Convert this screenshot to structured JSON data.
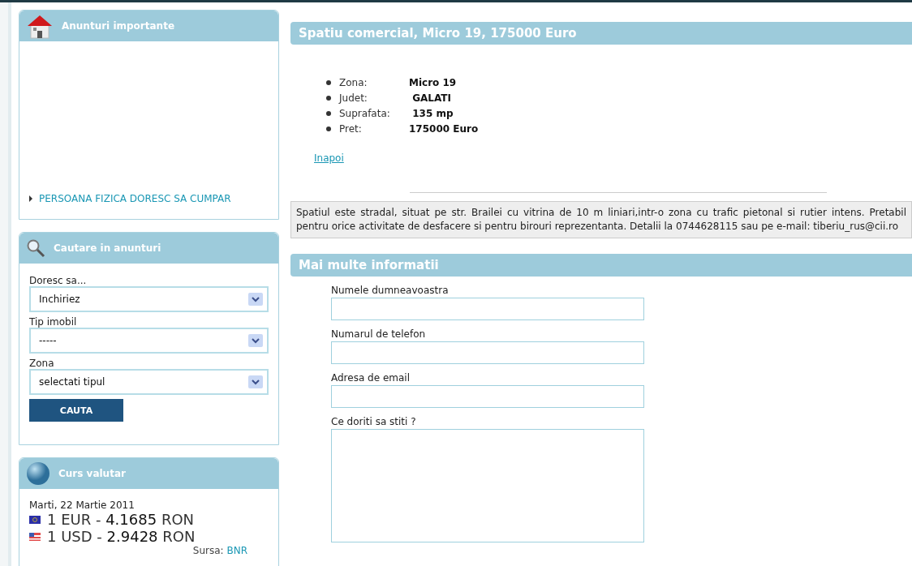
{
  "sidebar": {
    "important_ads": {
      "title": "Anunturi importante",
      "items": [
        "PERSOANA FIZICA DORESC SA CUMPAR"
      ]
    },
    "search": {
      "title": "Cautare in anunturi",
      "fields": [
        {
          "label": "Doresc sa...",
          "value": "Inchiriez"
        },
        {
          "label": "Tip imobil",
          "value": "-----"
        },
        {
          "label": "Zona",
          "value": "selectati tipul"
        }
      ],
      "button": "CAUTA"
    },
    "exchange": {
      "title": "Curs valutar",
      "date": "Marti, 22 Martie 2011",
      "rates": [
        {
          "kind": "eur",
          "unit": "1 EUR - ",
          "value": "4.1685",
          "currency": " RON"
        },
        {
          "kind": "usd",
          "unit": "1 USD - ",
          "value": "2.9428",
          "currency": " RON"
        }
      ],
      "source_label": "Sursa: ",
      "source_link": "BNR"
    }
  },
  "listing": {
    "title": "Spatiu comercial, Micro 19, 175000 Euro",
    "details": [
      {
        "label": "Zona:",
        "value": "Micro 19"
      },
      {
        "label": "Judet:",
        "value": " GALATI"
      },
      {
        "label": "Suprafata:",
        "value": " 135 mp"
      },
      {
        "label": "Pret:",
        "value": "175000 Euro"
      }
    ],
    "back_link": "Inapoi",
    "description": "Spatiul este stradal, situat pe str. Brailei cu vitrina de 10 m liniari,intr-o zona cu trafic pietonal si rutier intens. Pretabil pentru orice activitate de desfacere si pentru birouri reprezentanta. Detalii la 0744628115 sau pe e-mail: tiberiu_rus@cii.ro"
  },
  "contact_form": {
    "title": "Mai multe informatii",
    "fields": [
      {
        "kind": "input",
        "label": "Numele dumneavoastra"
      },
      {
        "kind": "input",
        "label": "Numarul de telefon"
      },
      {
        "kind": "input",
        "label": "Adresa de email"
      },
      {
        "kind": "textarea",
        "label": "Ce doriti sa stiti ?"
      }
    ]
  }
}
